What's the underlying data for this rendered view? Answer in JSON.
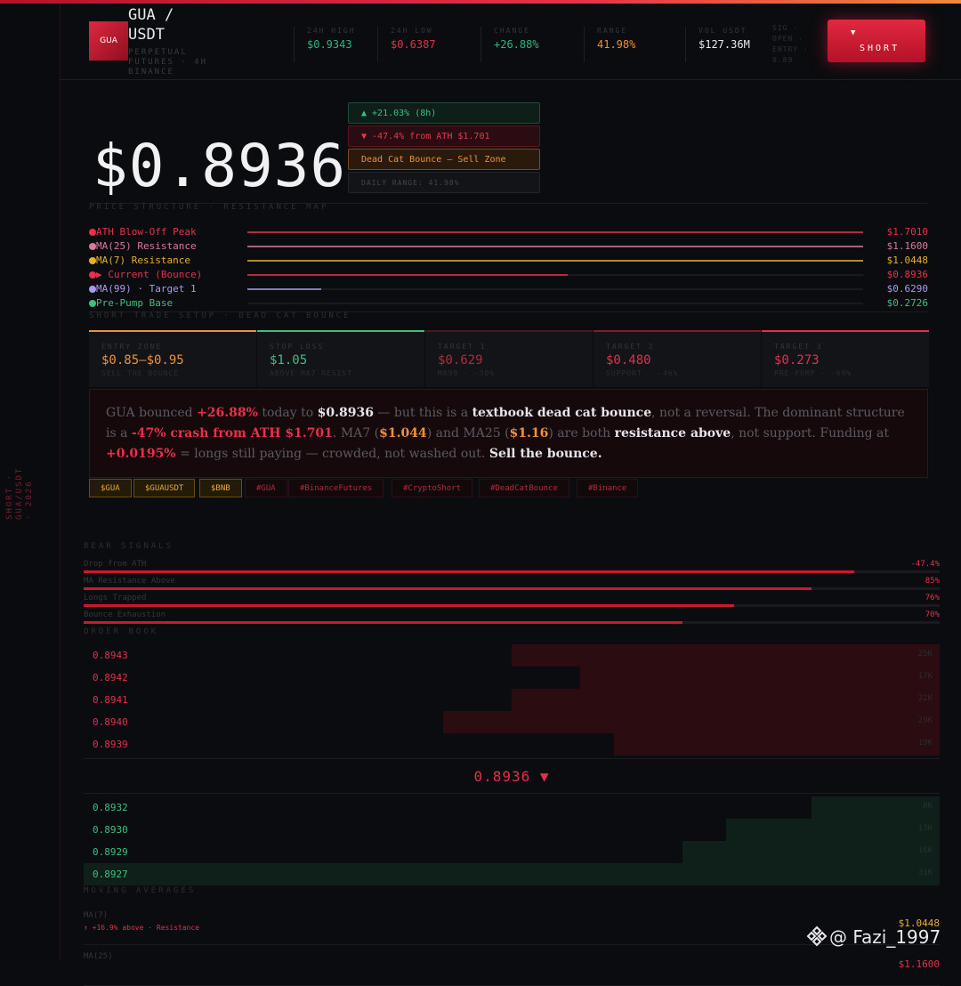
{
  "header": {
    "logo_text": "GUA",
    "pair": "GUA / USDT",
    "pair_sub": "PERPETUAL FUTURES · 4H BINANCE",
    "stats": [
      {
        "label": "24H HIGH",
        "value": "$0.9343",
        "color": "#2fb47d"
      },
      {
        "label": "24H LOW",
        "value": "$0.6387",
        "color": "#e3304a"
      },
      {
        "label": "CHANGE",
        "value": "+26.88%",
        "color": "#2fb47d"
      },
      {
        "label": "RANGE",
        "value": "41.98%",
        "color": "#f0913a"
      },
      {
        "label": "VOL USDT",
        "value": "$127.36M",
        "color": "#e9e9ee"
      }
    ],
    "ghost_text": "SIG · OPEN · ENTRY · 0.89",
    "short_button": {
      "arrow": "▼",
      "label": "SHORT"
    }
  },
  "sidebar": {
    "vertical_text": "SHORT · GUA/USDT · 2026"
  },
  "price": {
    "current": "$0.8936",
    "badges": [
      "▲ +21.03% (8h)",
      "▼ -47.4% from ATH $1.701",
      "Dead Cat Bounce — Sell Zone",
      "DAILY RANGE: 41.98%"
    ]
  },
  "structure": {
    "title": "PRICE STRUCTURE · RESISTANCE MAP",
    "levels": [
      {
        "name": "ATH Blow-Off Peak",
        "price": "$1.7010",
        "color": "#e8304a",
        "fill": 1.0
      },
      {
        "name": "MA(25) Resistance",
        "price": "$1.1600",
        "color": "#d77a9a",
        "fill": 1.0
      },
      {
        "name": "MA(7) Resistance",
        "price": "$1.0448",
        "color": "#e6b02e",
        "fill": 1.0
      },
      {
        "name": "▶ Current (Bounce)",
        "price": "$0.8936",
        "color": "#e8304a",
        "fill": 0.52
      },
      {
        "name": "MA(99) · Target 1",
        "price": "$0.6290",
        "color": "#a99af0",
        "fill": 0.12
      },
      {
        "name": "Pre-Pump Base",
        "price": "$0.2726",
        "color": "#3fbf7f",
        "fill": 0.0
      }
    ]
  },
  "setup": {
    "title": "SHORT TRADE SETUP · DEAD CAT BOUNCE",
    "cards": [
      {
        "label": "ENTRY ZONE",
        "value": "$0.85–$0.95",
        "sub": "SELL THE BOUNCE",
        "color": "#f0913a",
        "border": "#f0913a"
      },
      {
        "label": "STOP LOSS",
        "value": "$1.05",
        "sub": "ABOVE MA7 RESIST",
        "color": "#3fbf7f",
        "border": "#3fbf7f"
      },
      {
        "label": "TARGET 1",
        "value": "$0.629",
        "sub": "MA99 · -30%",
        "color": "#b32a3c",
        "border": "#4a1620"
      },
      {
        "label": "TARGET 2",
        "value": "$0.480",
        "sub": "SUPPORT · -46%",
        "color": "#e3304a",
        "border": "#8a1a2a"
      },
      {
        "label": "TARGET 3",
        "value": "$0.273",
        "sub": "PRE-PUMP · -69%",
        "color": "#e3304a",
        "border": "#e3304a"
      }
    ]
  },
  "description": {
    "t1": "GUA bounced ",
    "r1": "+26.88%",
    "t2": " today to ",
    "w1": "$0.8936",
    "t3": " — but this is a ",
    "w2": "textbook dead cat bounce",
    "t4": ", not a reversal. The dominant structure is a ",
    "r2": "-47% crash from ATH $1.701",
    "t5": ". MA7 (",
    "o1": "$1.044",
    "t6": ") and MA25 (",
    "o2": "$1.16",
    "t7": ") are both ",
    "w3": "resistance above",
    "t8": ", not support. Funding at ",
    "r3": "+0.0195%",
    "t9": " = longs still paying — crowded, not washed out. ",
    "w4": "Sell the bounce."
  },
  "tags": [
    {
      "label": "$GUA",
      "style": "gold"
    },
    {
      "label": "$GUAUSDT",
      "style": "gold"
    },
    {
      "label": "$BNB",
      "style": "gold"
    },
    {
      "label": "#GUA",
      "style": "red"
    },
    {
      "label": "#BinanceFutures",
      "style": "red"
    },
    {
      "label": "#CryptoShort",
      "style": "red"
    },
    {
      "label": "#DeadCatBounce",
      "style": "red"
    },
    {
      "label": "#Binance",
      "style": "red"
    }
  ],
  "bear_signals": {
    "title": "BEAR SIGNALS",
    "items": [
      {
        "name": "Drop from ATH",
        "pct": "-47.4%",
        "fill": 0.9
      },
      {
        "name": "MA Resistance Above",
        "pct": "85%",
        "fill": 0.85
      },
      {
        "name": "Longs Trapped",
        "pct": "76%",
        "fill": 0.76
      },
      {
        "name": "Bounce Exhaustion",
        "pct": "70%",
        "fill": 0.7
      }
    ]
  },
  "order_book": {
    "title": "ORDER BOOK",
    "asks": [
      {
        "price": "0.8943",
        "size": "25K",
        "depth": 0.5
      },
      {
        "price": "0.8942",
        "size": "17K",
        "depth": 0.42
      },
      {
        "price": "0.8941",
        "size": "22K",
        "depth": 0.5
      },
      {
        "price": "0.8940",
        "size": "29K",
        "depth": 0.58
      },
      {
        "price": "0.8939",
        "size": "19K",
        "depth": 0.38
      }
    ],
    "mid": "0.8936 ▼",
    "bids": [
      {
        "price": "0.8932",
        "size": "8K",
        "depth": 0.15
      },
      {
        "price": "0.8930",
        "size": "13K",
        "depth": 0.25
      },
      {
        "price": "0.8929",
        "size": "16K",
        "depth": 0.3
      },
      {
        "price": "0.8927",
        "size": "31K",
        "depth": 1.0
      }
    ]
  },
  "moving_averages": {
    "title": "MOVING AVERAGES",
    "items": [
      {
        "name": "MA(7)",
        "value": "$1.0448",
        "note": "↑ +16.9% above · Resistance",
        "color": "#e6b02e"
      },
      {
        "name": "MA(25)",
        "value": "$1.1600",
        "note": "",
        "color": "#e3304a"
      }
    ]
  },
  "watermark": "@ Fazi_1997"
}
